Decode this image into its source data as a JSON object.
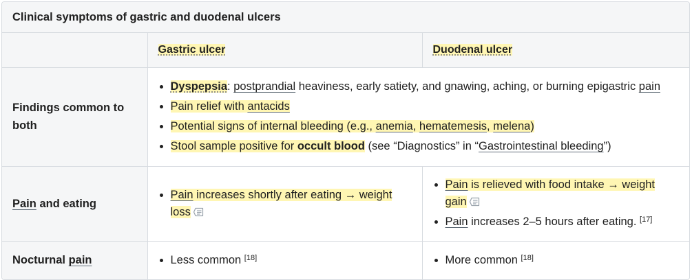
{
  "table": {
    "caption": "Clinical symptoms of gastric and duodenal ulcers",
    "header": {
      "col1": "",
      "col2": "Gastric ulcer",
      "col3": "Duodenal ulcer"
    },
    "rows": {
      "both": {
        "label": "Findings common to both",
        "item1": {
          "term": "Dyspepsia",
          "colon": ":",
          "link": "postprandial",
          "text": " heaviness, early satiety, and gnawing, aching, or burning epigastric ",
          "link2": "pain"
        },
        "item2": {
          "hl": "Pain relief with ",
          "link": "antacids"
        },
        "item3": {
          "hl1": "Potential signs of internal bleeding (e.g., ",
          "link1": "anemia",
          "sep1": ", ",
          "link2": "hematemesis",
          "sep2": ", ",
          "link3": "melena",
          "end": ")"
        },
        "item4": {
          "hl": "Stool sample positive for ",
          "bold": "occult blood",
          "text1": " (see “Diagnostics” in “",
          "link": "Gastrointestinal bleeding",
          "text2": "”)"
        }
      },
      "pain_eating": {
        "label_link": "Pain",
        "label_rest": " and eating",
        "gastric": {
          "link": "Pain",
          "hl": " increases shortly after eating → weight loss"
        },
        "duodenal1": {
          "link": "Pain",
          "hl": " is relieved with food intake → weight gain"
        },
        "duodenal2": {
          "link": "Pain",
          "text": " increases 2–5 hours after eating. ",
          "ref": "[17]"
        }
      },
      "nocturnal": {
        "label_text": "Nocturnal ",
        "label_link": "pain",
        "gastric": {
          "text": "Less common ",
          "ref": "[18]"
        },
        "duodenal": {
          "text": "More common ",
          "ref": "[18]"
        }
      }
    }
  },
  "icons": {
    "note": "note-icon"
  },
  "colors": {
    "highlight": "#fff6b3",
    "border": "#d7dbe0",
    "header_bg": "#f5f6f7"
  }
}
